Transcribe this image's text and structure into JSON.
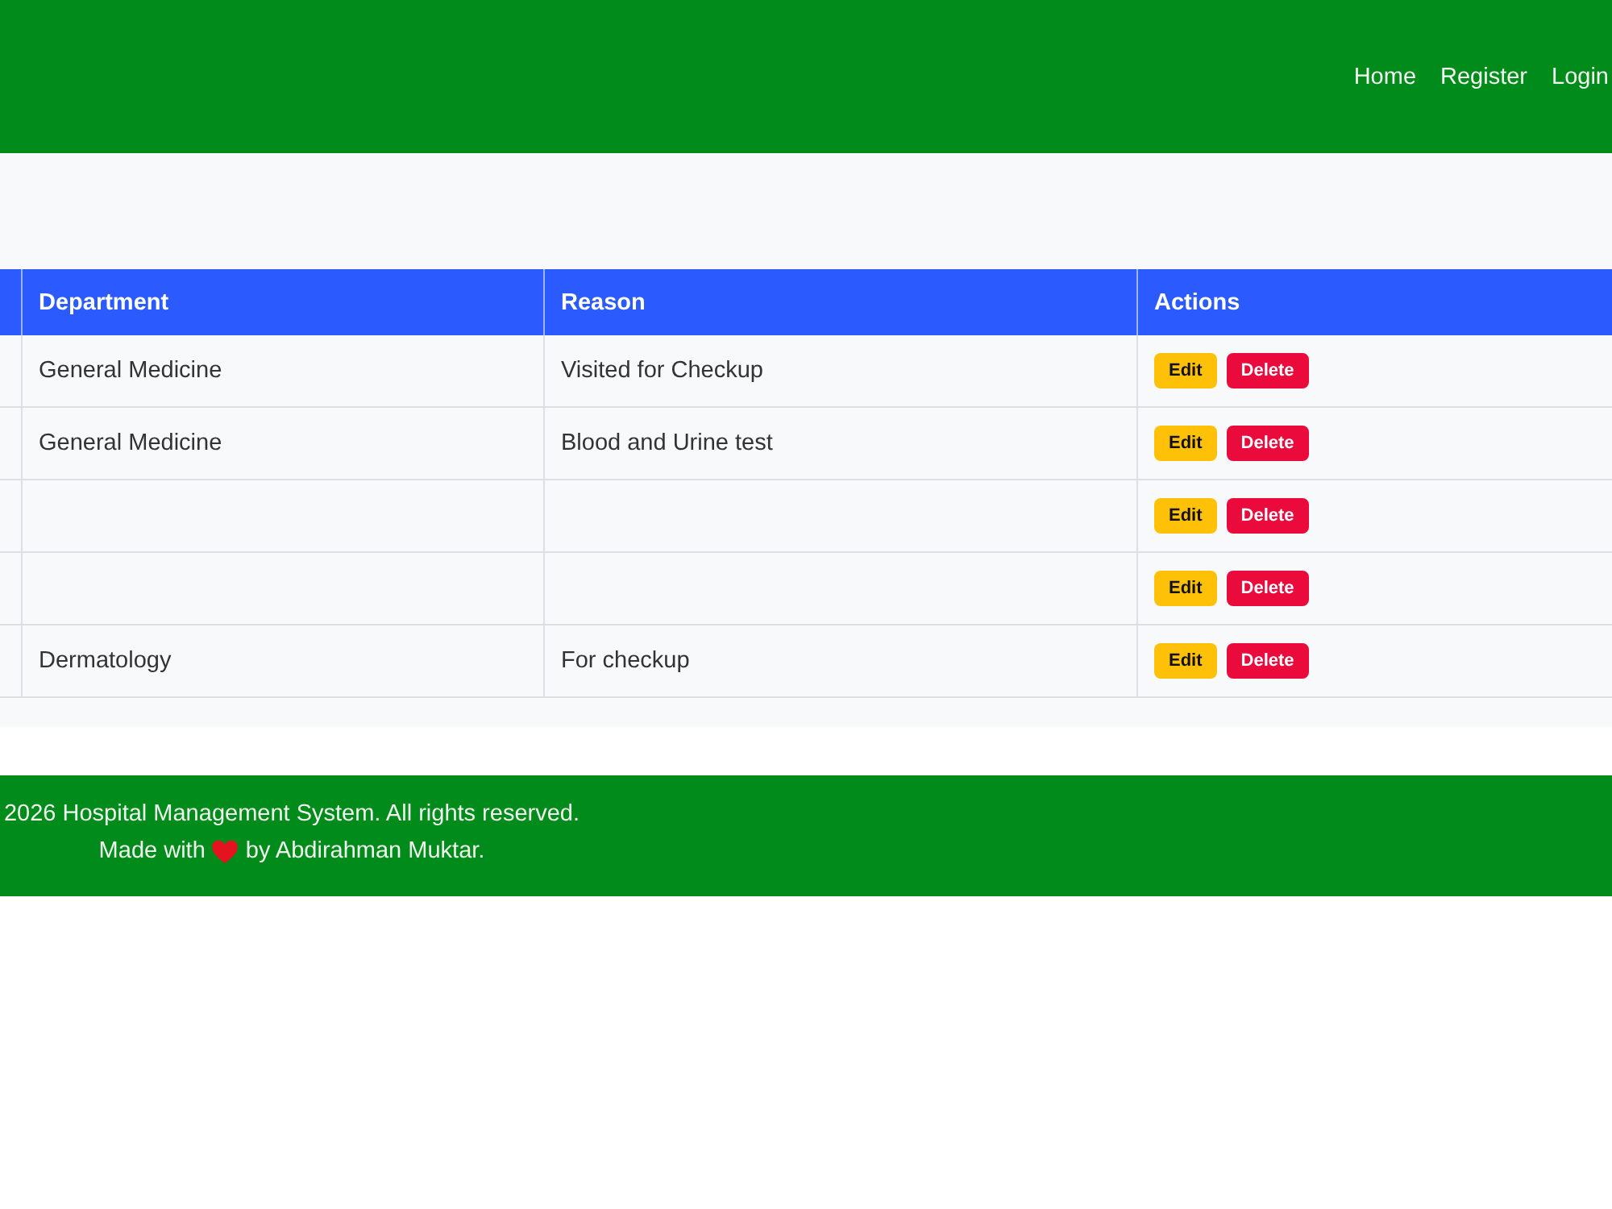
{
  "navbar": {
    "links": [
      {
        "label": "Home"
      },
      {
        "label": "Register"
      },
      {
        "label": "Login"
      }
    ]
  },
  "table": {
    "columns": [
      "Department",
      "Reason",
      "Actions"
    ],
    "rows": [
      {
        "department": "General Medicine",
        "reason": "Visited for Checkup",
        "actions": [
          {
            "label": "Edit",
            "kind": "edit"
          },
          {
            "label": "Delete",
            "kind": "delete"
          }
        ]
      },
      {
        "department": "General Medicine",
        "reason": "Blood and Urine test",
        "actions": [
          {
            "label": "Edit",
            "kind": "edit"
          },
          {
            "label": "Delete",
            "kind": "delete"
          }
        ]
      },
      {
        "actions": [
          {
            "label": "Edit",
            "kind": "edit"
          },
          {
            "label": "Delete",
            "kind": "delete"
          }
        ]
      },
      {
        "actions": [
          {
            "label": "Edit",
            "kind": "edit"
          },
          {
            "label": "Delete",
            "kind": "delete"
          }
        ]
      },
      {
        "department": "Dermatology",
        "reason": "For checkup",
        "actions": [
          {
            "label": "Edit",
            "kind": "edit"
          },
          {
            "label": "Delete",
            "kind": "delete"
          }
        ]
      }
    ]
  },
  "footer": {
    "copyright": "2026 Hospital Management System. All rights reserved.",
    "made_with": "Made with",
    "made_by": "by Abdirahman Muktar."
  }
}
